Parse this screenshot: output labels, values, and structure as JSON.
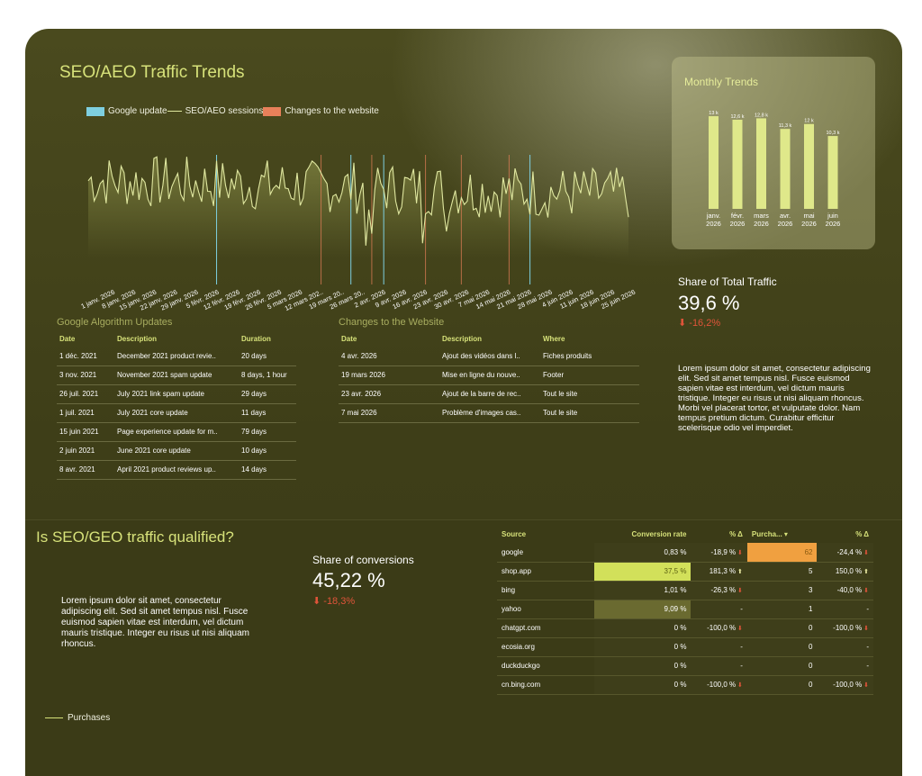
{
  "traffic": {
    "title": "SEO/AEO Traffic Trends",
    "legend": [
      {
        "label": "Google update",
        "color": "#7ecfe0",
        "kind": "swatch"
      },
      {
        "label": "SEO/AEO sessions",
        "color": "#e0e8a0",
        "kind": "line"
      },
      {
        "label": "Changes to the website",
        "color": "#e8805a",
        "kind": "swatch"
      }
    ],
    "x_ticks": [
      "1 janv. 2026",
      "8 janv. 2026",
      "15 janv. 2026",
      "22 janv. 2026",
      "29 janv. 2026",
      "5 févr. 2026",
      "12 févr. 2026",
      "19 févr. 2026",
      "26 févr. 2026",
      "5 mars 2026",
      "12 mars 202..",
      "19 mars 20..",
      "26 mars 20..",
      "2 avr. 2026",
      "9 avr. 2026",
      "16 avr. 2026",
      "23 avr. 2026",
      "30 avr. 2026",
      "7 mai 2026",
      "14 mai 2026",
      "21 mai 2026",
      "28 mai 2026",
      "4 juin 2026",
      "11 juin 2026",
      "18 juin 2026",
      "25 juin 2026"
    ]
  },
  "chart_data": [
    {
      "type": "line",
      "title": "SEO/AEO Traffic Trends",
      "series": [
        {
          "name": "SEO/AEO sessions",
          "points": 182
        }
      ],
      "google_update_markers": [
        43,
        88,
        99,
        148,
        196
      ],
      "website_change_markers": [
        78,
        95,
        113,
        125,
        141
      ],
      "grid": false
    },
    {
      "type": "bar",
      "title": "Monthly Trends",
      "categories": [
        "janv. 2026",
        "févr. 2026",
        "mars 2026",
        "avr. 2026",
        "mai 2026",
        "juin 2026"
      ],
      "values": [
        13.1,
        12.6,
        12.8,
        11.3,
        12.0,
        10.3
      ],
      "data_labels": [
        "13 k",
        "12,6 k",
        "12,8 k",
        "11,3 k",
        "12 k",
        "10,3 k"
      ],
      "ylim": [
        0,
        14
      ]
    }
  ],
  "monthly": {
    "title": "Monthly Trends",
    "categories_line1": [
      "janv.",
      "févr.",
      "mars",
      "avr.",
      "mai",
      "juin"
    ],
    "categories_line2": [
      "2026",
      "2026",
      "2026",
      "2026",
      "2026",
      "2026"
    ]
  },
  "share_traffic": {
    "label": "Share of Total Traffic",
    "value": "39,6 %",
    "delta": "-16,2%",
    "paragraph": "Lorem ipsum dolor sit amet, consectetur adipiscing elit. Sed sit amet tempus nisl. Fusce euismod sapien vitae est interdum, vel dictum mauris tristique. Integer eu risus ut nisi aliquam rhoncus. Morbi vel placerat tortor, et vulputate dolor. Nam tempus pretium dictum. Curabitur efficitur scelerisque odio vel imperdiet."
  },
  "google_updates": {
    "title": "Google Algorithm Updates",
    "headers": [
      "Date",
      "Description",
      "Duration"
    ],
    "rows": [
      [
        "1 déc. 2021",
        "December 2021 product revie..",
        "20 days"
      ],
      [
        "3 nov. 2021",
        "November 2021 spam update",
        "8 days, 1 hour"
      ],
      [
        "26 juil. 2021",
        "July 2021 link spam update",
        "29 days"
      ],
      [
        "1 juil. 2021",
        "July 2021 core update",
        "11 days"
      ],
      [
        "15 juin 2021",
        "Page experience update for m..",
        "79 days"
      ],
      [
        "2 juin 2021",
        "June 2021 core update",
        "10 days"
      ],
      [
        "8 avr. 2021",
        "April 2021 product reviews up..",
        "14 days"
      ]
    ]
  },
  "website_changes": {
    "title": "Changes to the Website",
    "headers": [
      "Date",
      "Description",
      "Where"
    ],
    "rows": [
      [
        "4 avr. 2026",
        "Ajout des vidéos dans l..",
        "Fiches produits"
      ],
      [
        "19 mars 2026",
        "Mise en ligne du nouve..",
        "Footer"
      ],
      [
        "23 avr. 2026",
        "Ajout de la barre de rec..",
        "Tout le site"
      ],
      [
        "7 mai 2026",
        "Problème d'images cas..",
        "Tout le site"
      ]
    ]
  },
  "qualified": {
    "title": "Is SEO/GEO traffic qualified?",
    "paragraph": "Lorem ipsum dolor sit amet, consectetur adipiscing elit. Sed sit amet tempus nisl. Fusce euismod sapien vitae est interdum, vel dictum mauris tristique. Integer eu risus ut nisi aliquam rhoncus."
  },
  "share_conversions": {
    "label": "Share of conversions",
    "value": "45,22 %",
    "delta": "-18,3%"
  },
  "sources": {
    "headers": [
      "Source",
      "Conversion rate",
      "% Δ",
      "Purcha... ▾",
      "% Δ"
    ],
    "rows": [
      {
        "source": "google",
        "rate": "0,83 %",
        "rate_pct": 0.83,
        "d1": "-18,9 %",
        "d1_dir": "down",
        "purch": "62",
        "purch_n": 62,
        "d2": "-24,4 %",
        "d2_dir": "down"
      },
      {
        "source": "shop.app",
        "rate": "37,5 %",
        "rate_pct": 37.5,
        "d1": "181,3 %",
        "d1_dir": "up",
        "purch": "5",
        "purch_n": 5,
        "d2": "150,0 %",
        "d2_dir": "up"
      },
      {
        "source": "bing",
        "rate": "1,01 %",
        "rate_pct": 1.01,
        "d1": "-26,3 %",
        "d1_dir": "down",
        "purch": "3",
        "purch_n": 3,
        "d2": "-40,0 %",
        "d2_dir": "down"
      },
      {
        "source": "yahoo",
        "rate": "9,09 %",
        "rate_pct": 9.09,
        "d1": "-",
        "d1_dir": "none",
        "purch": "1",
        "purch_n": 1,
        "d2": "-",
        "d2_dir": "none"
      },
      {
        "source": "chatgpt.com",
        "rate": "0 %",
        "rate_pct": 0,
        "d1": "-100,0 %",
        "d1_dir": "down",
        "purch": "0",
        "purch_n": 0,
        "d2": "-100,0 %",
        "d2_dir": "down"
      },
      {
        "source": "ecosia.org",
        "rate": "0 %",
        "rate_pct": 0,
        "d1": "-",
        "d1_dir": "none",
        "purch": "0",
        "purch_n": 0,
        "d2": "-",
        "d2_dir": "none"
      },
      {
        "source": "duckduckgo",
        "rate": "0 %",
        "rate_pct": 0,
        "d1": "-",
        "d1_dir": "none",
        "purch": "0",
        "purch_n": 0,
        "d2": "-",
        "d2_dir": "none"
      },
      {
        "source": "cn.bing.com",
        "rate": "0 %",
        "rate_pct": 0,
        "d1": "-100,0 %",
        "d1_dir": "down",
        "purch": "0",
        "purch_n": 0,
        "d2": "-100,0 %",
        "d2_dir": "down"
      }
    ]
  },
  "bottom_legend": {
    "label": "Purchases"
  },
  "colors": {
    "accent": "#d7e27a",
    "line": "#e0e8a0",
    "google_update": "#7ecfe0",
    "website_change": "#e8805a",
    "negative": "#e0543a",
    "highlight_orange": "#f0a040"
  }
}
